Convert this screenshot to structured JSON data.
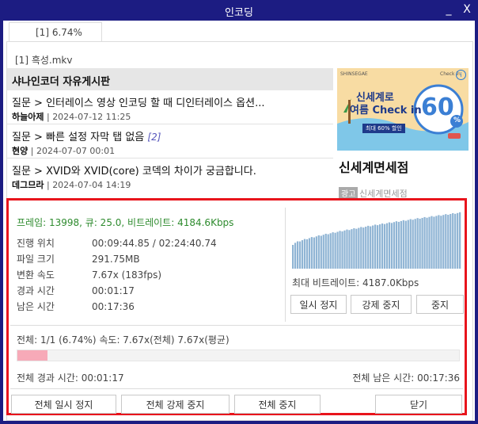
{
  "window": {
    "title": "인코딩",
    "minimize_label": "_",
    "close_label": "X"
  },
  "tab": {
    "label": "[1] 6.74%"
  },
  "file": {
    "name": "[1] 흑성.mkv"
  },
  "board": {
    "title": "샤나인코더 자유게시판",
    "posts": [
      {
        "title": "질문 > 인터레이스 영상 인코딩 할 때 디인터레이스 옵션...",
        "count": "",
        "author": "하늘아제",
        "date": "2024-07-12 11:25"
      },
      {
        "title": "질문 > 빠른 설정 자막 탭 없음",
        "count": "[2]",
        "author": "현양",
        "date": "2024-07-07 00:01"
      },
      {
        "title": "질문 > XVID와 XVID(core) 코덱의 차이가 궁금합니다.",
        "count": "",
        "author": "데그므라",
        "date": "2024-07-04 14:19"
      }
    ]
  },
  "ad": {
    "banner_line1": "신세계로",
    "banner_line2": "여름 Check in",
    "banner_number": "60",
    "banner_pct": "%",
    "banner_badge": "최대 60% 할인",
    "banner_brand": "SHINSEGAE",
    "banner_brand2": "Check in",
    "title": "신세계면세점",
    "tag": "광고",
    "sub": "신세계면세점",
    "info": "i"
  },
  "stats": {
    "summary": "프레임: 13998, 큐: 25.0, 비트레이트: 4184.6Kbps",
    "rows": [
      {
        "label": "진행 위치",
        "value": "00:09:44.85 / 02:24:40.74"
      },
      {
        "label": "파일 크기",
        "value": "291.75MB"
      },
      {
        "label": "변환 속도",
        "value": "7.67x (183fps)"
      },
      {
        "label": "경과 시간",
        "value": "00:01:17"
      },
      {
        "label": "남은 시간",
        "value": "00:17:36"
      }
    ],
    "max_bitrate": "최대 비트레이트: 4187.0Kbps",
    "graph_color": "#8fb4d4"
  },
  "buttons": {
    "pause": "일시 정지",
    "force_stop": "강제 중지",
    "stop": "중지"
  },
  "overall": {
    "summary": "전체: 1/1 (6.74%) 속도: 7.67x(전체) 7.67x(평균)",
    "progress": 0.0674,
    "progress_color": "#f7aab8",
    "elapsed": "전체 경과 시간: 00:01:17",
    "remaining": "전체 남은 시간: 00:17:36"
  },
  "bottom_buttons": {
    "pause_all": "전체 일시 정지",
    "force_stop_all": "전체 강제 중지",
    "stop_all": "전체 중지",
    "close": "닫기"
  },
  "colors": {
    "title_bar": "#1c1c82",
    "highlight_border": "#e8141c",
    "summary_text": "#2e8b2e"
  }
}
